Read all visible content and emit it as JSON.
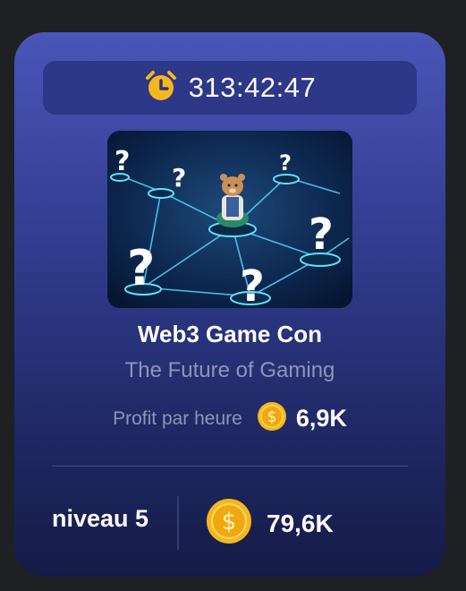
{
  "card": {
    "timer": "313:42:47",
    "title": "Web3 Game Con",
    "subtitle": "The Future of Gaming",
    "profit_label": "Profit par heure",
    "profit_value": "6,9K",
    "level": "niveau 5",
    "cost": "79,6K"
  },
  "icons": {
    "timer": "alarm-clock-icon",
    "coin": "gold-dollar-coin-icon"
  },
  "colors": {
    "card_top": "#4a56b8",
    "card_bottom": "#151b46",
    "coin": "#f5b81c",
    "muted_text": "#8f95b8"
  }
}
